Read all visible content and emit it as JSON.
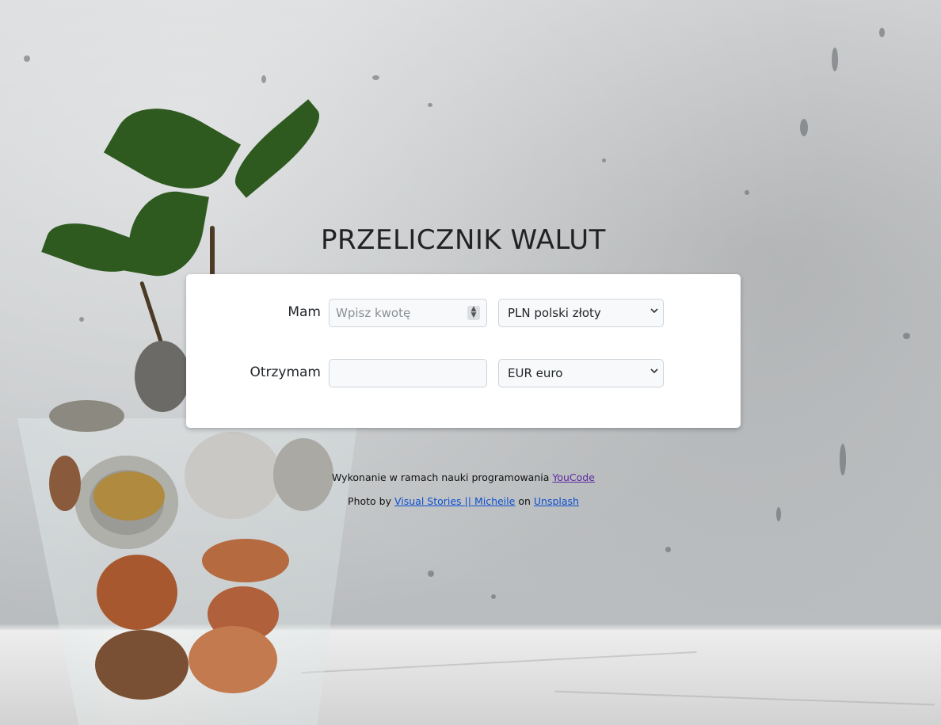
{
  "page": {
    "title": "PRZELICZNIK WALUT"
  },
  "form": {
    "have": {
      "label": "Mam",
      "amount_placeholder": "Wpisz kwotę",
      "amount_value": "",
      "currency": "PLN polski złoty"
    },
    "receive": {
      "label": "Otrzymam",
      "amount_value": "",
      "currency": "EUR euro"
    }
  },
  "footer": {
    "line1_text": "Wykonanie w ramach nauki programowania",
    "line1_link": "YouCode",
    "line2_prefix": "Photo by",
    "line2_author": "Visual Stories || Micheile",
    "line2_on": "on",
    "line2_site": "Unsplash"
  },
  "colors": {
    "link": "#0b4fd1",
    "visited_link": "#5b2aa0",
    "card_bg": "#ffffff",
    "field_bg": "#f8f9fa"
  },
  "icons": {
    "spinner": "number-spinner-icon",
    "select_chevron": "chevron-down-icon"
  }
}
